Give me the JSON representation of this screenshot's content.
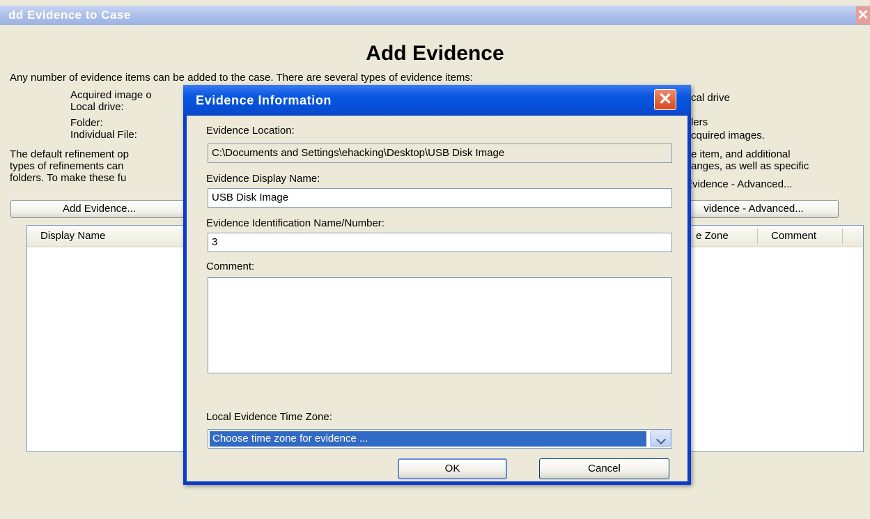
{
  "window": {
    "title": "dd Evidence to Case",
    "close_glyph": "✕"
  },
  "main": {
    "heading": "Add Evidence",
    "intro": "Any number of evidence items can be added to the case. There are several types of evidence items:",
    "types_left": [
      "Acquired image o",
      "Local drive:",
      "Folder:",
      "Individual File:"
    ],
    "types_right": [
      "cal drive",
      "lers",
      "cquired images."
    ],
    "refinement_left": [
      "The default refinement op",
      "types of refinements can",
      "folders. To make these fu"
    ],
    "refinement_right": [
      "e item, and additional",
      "anges, as well as specific",
      "Evidence - Advanced..."
    ],
    "add_evidence_button": "Add Evidence...",
    "add_evidence_advanced_button": "vidence - Advanced...",
    "columns": [
      "Display Name",
      "e Zone",
      "Comment"
    ]
  },
  "dialog": {
    "title": "Evidence Information",
    "close_glyph": "✕",
    "location_label": "Evidence Location:",
    "location_value": "C:\\Documents and Settings\\ehacking\\Desktop\\USB Disk Image",
    "display_name_label": "Evidence Display Name:",
    "display_name_value": "USB Disk Image",
    "id_label": "Evidence Identification Name/Number:",
    "id_value": "3",
    "comment_label": "Comment:",
    "comment_value": "",
    "timezone_label": "Local Evidence Time Zone:",
    "timezone_value": "Choose time zone for evidence ...",
    "ok_label": "OK",
    "cancel_label": "Cancel"
  },
  "colors": {
    "dialog_title": "#0a58e0",
    "selection": "#316ac5",
    "close_button": "#d7471f",
    "window_face": "#ece9d8"
  }
}
